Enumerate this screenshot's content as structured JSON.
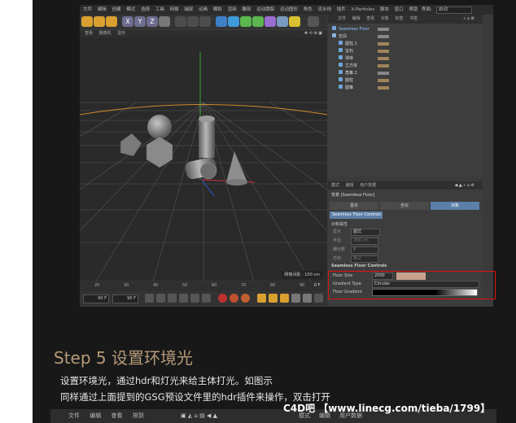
{
  "menubar": {
    "items": [
      "文件",
      "编辑",
      "创建",
      "模式",
      "选择",
      "工具",
      "网格",
      "捕捉",
      "动画",
      "模拟",
      "渲染",
      "雕刻",
      "运动跟踪",
      "运动图形",
      "角色",
      "流水线",
      "插件",
      "X-Particles",
      "脚本",
      "窗口",
      "帮助"
    ],
    "layout_label": "界面:",
    "layout_value": "启动"
  },
  "viewport": {
    "menu": [
      "查看",
      "摄像机",
      "显示",
      "选项",
      "过滤",
      "面板"
    ],
    "grid_label": "网格间距 : 100 cm"
  },
  "timeline": {
    "ticks": [
      "20",
      "30",
      "40",
      "50",
      "60",
      "70",
      "80",
      "90"
    ],
    "current_frame": "0 F",
    "frame_start": "90 F",
    "frame_end": "90 F"
  },
  "object_manager": {
    "menu": [
      "文件",
      "编辑",
      "查看",
      "对象",
      "标签",
      "书签"
    ],
    "objects": [
      {
        "name": "Seamless Floor",
        "indent": 0,
        "highlight": true
      },
      {
        "name": "空白",
        "indent": 0,
        "highlight": false
      },
      {
        "name": "圆柱.1",
        "indent": 1,
        "highlight": false
      },
      {
        "name": "宝石",
        "indent": 1,
        "highlight": false
      },
      {
        "name": "球体",
        "indent": 1,
        "highlight": false
      },
      {
        "name": "立方体",
        "indent": 1,
        "highlight": false
      },
      {
        "name": "角锥.2",
        "indent": 1,
        "highlight": false
      },
      {
        "name": "圆柱",
        "indent": 1,
        "highlight": false
      },
      {
        "name": "圆锥",
        "indent": 1,
        "highlight": false
      }
    ]
  },
  "attributes": {
    "menu": [
      "模式",
      "编辑",
      "用户数据"
    ],
    "title": "背景 [Seamless Floor]",
    "tabs": [
      "基本",
      "坐标",
      "对象"
    ],
    "active_tab": 2,
    "section_badge": "Seamless Floor Controls",
    "object_props_label": "对象属性",
    "props": [
      {
        "label": "显示",
        "value": "图式"
      },
      {
        "label": "半径",
        "value": "200 cm"
      },
      {
        "label": "细分数",
        "value": "8"
      },
      {
        "label": "方向",
        "value": "默认"
      }
    ],
    "seamless_header": "Seamless Floor Controls",
    "floor_size_label": "Floor Size",
    "floor_size_value": "2000",
    "gradient_type_label": "Gradient Type",
    "gradient_type_value": "Circular",
    "floor_gradient_label": "Floor Gradient"
  },
  "article": {
    "step": "Step 5  设置环境光",
    "line1": "设置环境光，通过hdr和灯光来给主体打光。如图示",
    "line2": "同样通过上面提到的GSG预设文件里的hdr插件来操作，双击打开"
  },
  "bottom_strip": {
    "left_items": [
      "文件",
      "编辑",
      "查看",
      "排到"
    ],
    "right_items": [
      "模式",
      "编辑",
      "用户数据"
    ]
  },
  "watermark": "C4D吧 【www.linecg.com/tieba/1799】",
  "colors": {
    "accent": "#5b7fa8",
    "highlight_box": "#dd1111",
    "step_text": "#b59a7a",
    "floor_line": "#d08a2a"
  }
}
